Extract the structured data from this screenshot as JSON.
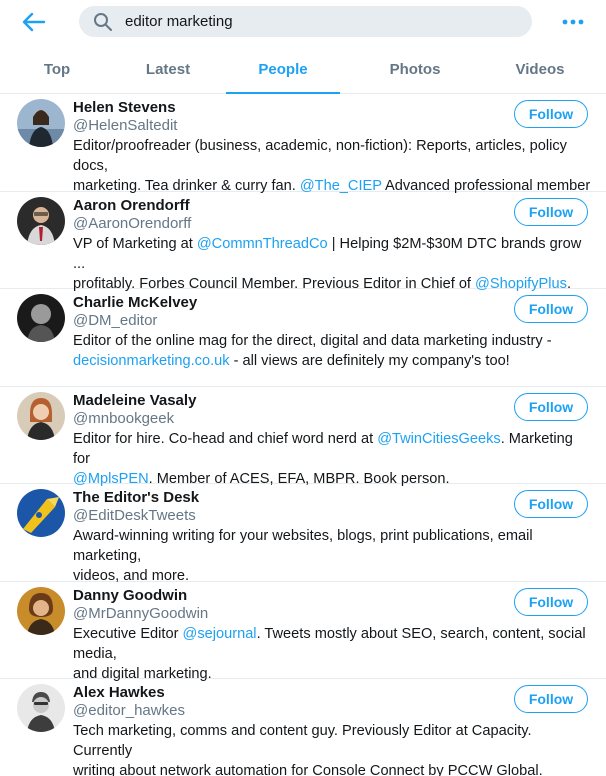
{
  "search": {
    "query": "editor marketing"
  },
  "tabs": [
    "Top",
    "Latest",
    "People",
    "Photos",
    "Videos"
  ],
  "active_tab": "People",
  "colors": {
    "accent": "#1da1f2",
    "secondary_text": "#657786",
    "divider": "#e6ecf0",
    "search_bg": "#e6ecf0"
  },
  "icons": {
    "back": "arrow-left-icon",
    "search": "magnifier-icon",
    "more": "more-dots-icon"
  },
  "follow_label": "Follow",
  "users": [
    {
      "name": "Helen Stevens",
      "handle": "@HelenSaltedit",
      "bio": [
        {
          "t": "Editor/proofreader (business, academic, non-fiction): Reports, articles, policy docs,\nmarketing. Tea drinker & curry fan. "
        },
        {
          "t": "@The_CIEP",
          "link": true
        },
        {
          "t": " Advanced professional member"
        }
      ]
    },
    {
      "name": "Aaron Orendorff",
      "handle": "@AaronOrendorff",
      "bio": [
        {
          "t": "VP of Marketing at "
        },
        {
          "t": "@CommnThreadCo",
          "link": true
        },
        {
          "t": " | Helping $2M-$30M DTC brands grow ...\nprofitably. Forbes Council Member. Previous Editor in Chief of "
        },
        {
          "t": "@ShopifyPlus",
          "link": true
        },
        {
          "t": "."
        }
      ]
    },
    {
      "name": "Charlie McKelvey",
      "handle": "@DM_editor",
      "bio": [
        {
          "t": "Editor of the online mag for the direct, digital and data marketing industry -\n"
        },
        {
          "t": "decisionmarketing.co.uk",
          "link": true
        },
        {
          "t": " - all views are definitely my company's too!"
        }
      ]
    },
    {
      "name": "Madeleine Vasaly",
      "handle": "@mnbookgeek",
      "bio": [
        {
          "t": "Editor for hire. Co-head and chief word nerd at "
        },
        {
          "t": "@TwinCitiesGeeks",
          "link": true
        },
        {
          "t": ". Marketing for\n"
        },
        {
          "t": "@MplsPEN",
          "link": true
        },
        {
          "t": ". Member of ACES, EFA, MBPR. Book person."
        }
      ]
    },
    {
      "name": "The Editor's Desk",
      "handle": "@EditDeskTweets",
      "bio": [
        {
          "t": "Award-winning writing for your websites, blogs, print publications, email marketing,\nvideos, and more."
        }
      ]
    },
    {
      "name": "Danny Goodwin",
      "handle": "@MrDannyGoodwin",
      "bio": [
        {
          "t": "Executive Editor "
        },
        {
          "t": "@sejournal",
          "link": true
        },
        {
          "t": ". Tweets mostly about SEO, search, content, social media,\nand digital marketing."
        }
      ]
    },
    {
      "name": "Alex Hawkes",
      "handle": "@editor_hawkes",
      "bio": [
        {
          "t": "Tech marketing, comms and content guy. Previously Editor at Capacity. Currently\nwriting about network automation for Console Connect by PCCW Global."
        }
      ]
    }
  ]
}
